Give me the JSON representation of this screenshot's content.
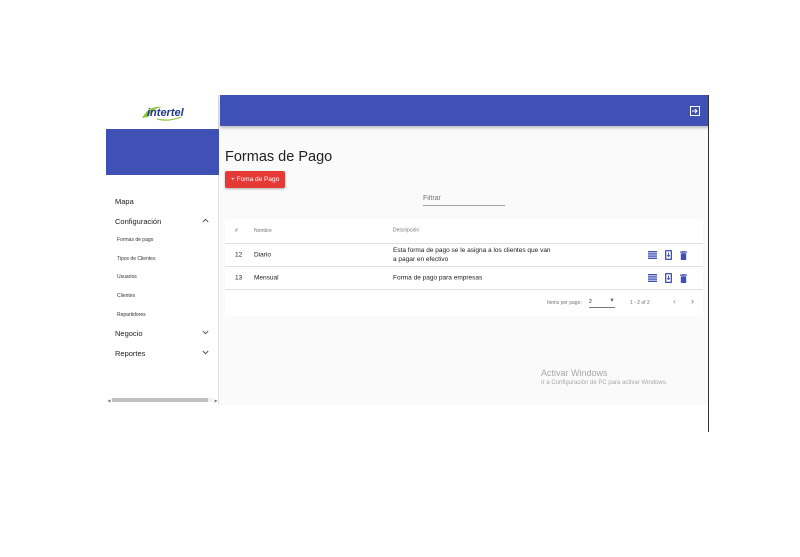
{
  "brand": {
    "logo_text": "intertel"
  },
  "sidebar": {
    "items": [
      {
        "label": "Mapa"
      },
      {
        "label": "Configuración",
        "children": [
          "Formas de pago",
          "Tipos de Clientes",
          "Usuarios",
          "Clientes",
          "Repartidores"
        ]
      },
      {
        "label": "Negocio"
      },
      {
        "label": "Reportes"
      }
    ]
  },
  "main": {
    "title": "Formas de Pago",
    "add_button": "+ Foma de Pago",
    "filter_placeholder": "Filtrar",
    "table": {
      "columns": [
        "#",
        "Nombre",
        "Descripción"
      ],
      "rows": [
        {
          "id": "12",
          "name": "Diario",
          "description": "Esta forma de pago se le asigna a los clientes que van a pagar en efectivo"
        },
        {
          "id": "13",
          "name": "Mensual",
          "description": "Forma de pago para empresas"
        }
      ]
    },
    "paginator": {
      "items_per_page_label": "Items per page:",
      "items_per_page": "2",
      "range": "1 - 2 of 2"
    }
  },
  "watermark": {
    "title": "Activar Windows",
    "subtitle": "Ir a Configuración de PC para activar Windows."
  },
  "colors": {
    "primary": "#3f51b5",
    "accent": "#e53935",
    "action_icons": "#3f51b5"
  }
}
